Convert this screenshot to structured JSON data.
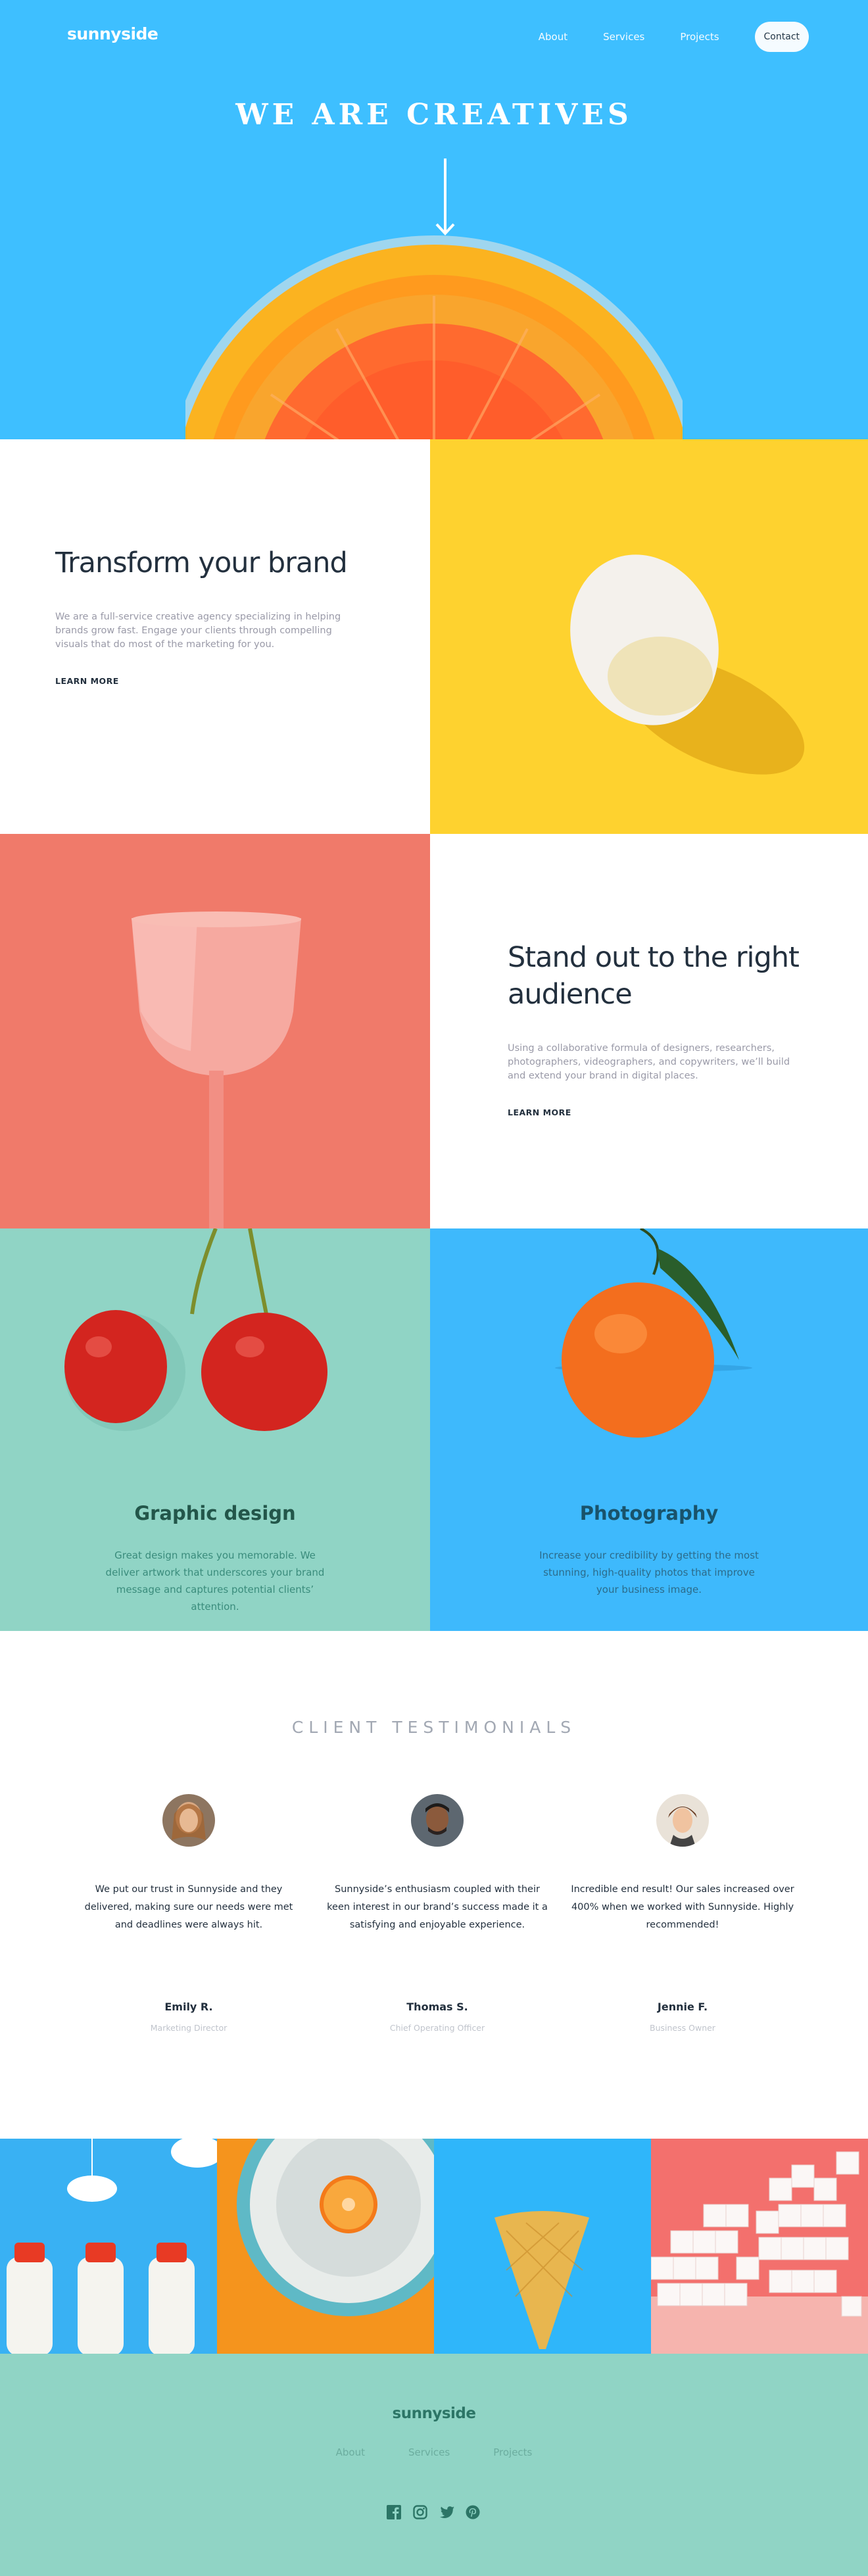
{
  "header": {
    "logo": "sunnyside",
    "nav": [
      "About",
      "Services",
      "Projects"
    ],
    "contact_label": "Contact"
  },
  "hero": {
    "title": "WE ARE CREATIVES"
  },
  "features": {
    "transform": {
      "title": "Transform your brand",
      "body": "We are a full-service creative agency specializing in helping brands grow fast. Engage your clients through compelling visuals that do most of the marketing for you.",
      "cta": "LEARN MORE"
    },
    "standout": {
      "title": "Stand out to the right audience",
      "body": "Using a collaborative formula of designers, researchers, photographers, videographers, and copywriters, we’ll build and extend your brand in digital places.",
      "cta": "LEARN MORE"
    }
  },
  "services": {
    "graphic": {
      "title": "Graphic design",
      "body": "Great design makes you memorable. We deliver artwork that underscores your brand message and captures potential clients’ attention."
    },
    "photo": {
      "title": "Photography",
      "body": "Increase your credibility by getting the most stunning, high-quality photos that improve your business image."
    }
  },
  "testimonials": {
    "heading": "CLIENT TESTIMONIALS",
    "items": [
      {
        "quote": "We put our trust in Sunnyside and they delivered, making sure our needs were met and deadlines were always hit.",
        "name": "Emily R.",
        "role": "Marketing Director"
      },
      {
        "quote": "Sunnyside’s enthusiasm coupled with their keen interest in our brand’s success made it a satisfying and enjoyable experience.",
        "name": "Thomas S.",
        "role": "Chief Operating Officer"
      },
      {
        "quote": "Incredible end result! Our sales increased over 400% when we worked with Sunnyside. Highly recommended!",
        "name": "Jennie F.",
        "role": "Business Owner"
      }
    ]
  },
  "footer": {
    "logo": "sunnyside",
    "nav": [
      "About",
      "Services",
      "Projects"
    ],
    "social_icons": [
      "facebook-icon",
      "instagram-icon",
      "twitter-icon",
      "pinterest-icon"
    ]
  },
  "colors": {
    "hero_bg": "#3ebfff",
    "yellow": "#fed22f",
    "coral": "#f07a6a",
    "mint": "#90d4c5",
    "sky": "#3eb9fc",
    "dark_text": "#23303e"
  }
}
